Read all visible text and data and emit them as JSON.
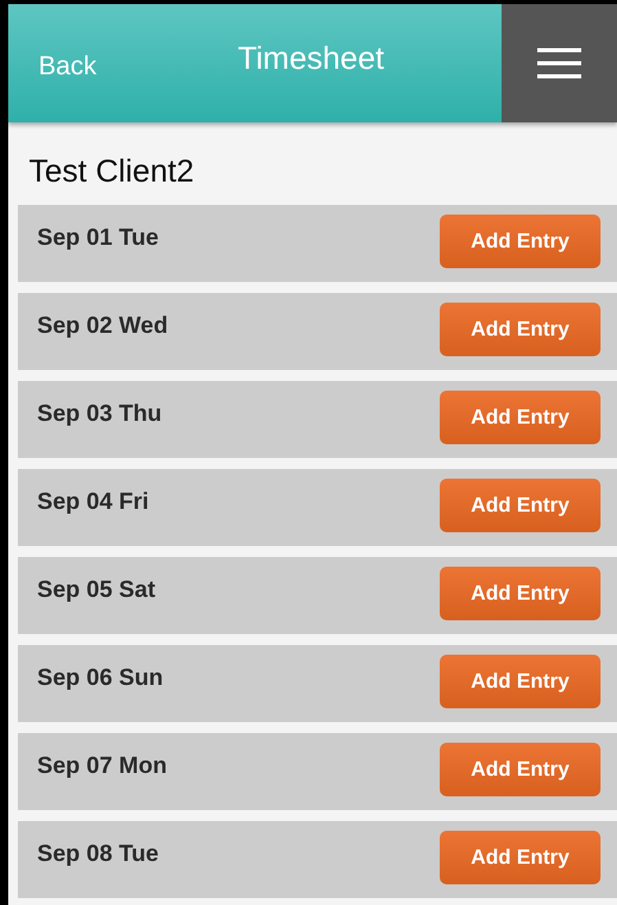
{
  "header": {
    "back": "Back",
    "title": "Timesheet"
  },
  "client": "Test Client2",
  "days": [
    {
      "date": "Sep 01 Tue",
      "action": "Add Entry"
    },
    {
      "date": "Sep 02 Wed",
      "action": "Add Entry"
    },
    {
      "date": "Sep 03 Thu",
      "action": "Add Entry"
    },
    {
      "date": "Sep 04 Fri",
      "action": "Add Entry"
    },
    {
      "date": "Sep 05 Sat",
      "action": "Add Entry"
    },
    {
      "date": "Sep 06 Sun",
      "action": "Add Entry"
    },
    {
      "date": "Sep 07 Mon",
      "action": "Add Entry"
    },
    {
      "date": "Sep 08 Tue",
      "action": "Add Entry"
    }
  ]
}
